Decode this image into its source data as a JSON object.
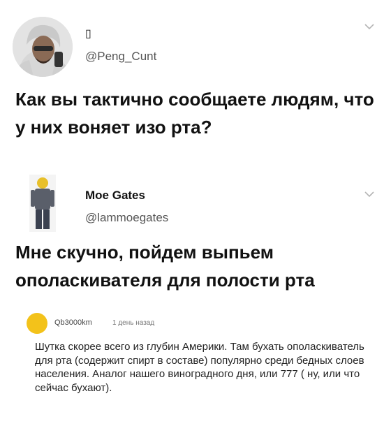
{
  "tweet1": {
    "name": "▯",
    "handle": "@Peng_Cunt",
    "text": "Как вы тактично сообщаете людям, что у них воняет изо рта?"
  },
  "tweet2": {
    "name": "Moe Gates",
    "handle": "@lammoegates",
    "text": "Мне скучно, пойдем выпьем ополаскивателя для полости рта"
  },
  "comment": {
    "username": "Qb3000km",
    "time": "1 день назад",
    "text": "Шутка скорее всего из глубин Америки. Там бухать ополаскиватель для рта (содержит спирт в составе) популярно среди бедных слоев населения. Аналог нашего виноградного дня, или 777 ( ну, или что сейчас бухают)."
  },
  "colors": {
    "handle": "#555555",
    "chevron": "#b5b5b5",
    "comment_avatar": "#f3c21a"
  },
  "icons": [
    "chevron-down-icon",
    "chevron-down-icon"
  ]
}
